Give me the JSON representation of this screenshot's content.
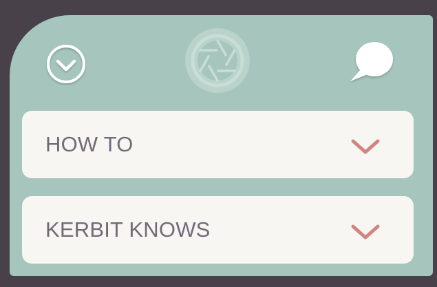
{
  "header": {
    "collapse_icon": "chevron-down-circle-icon",
    "logo_icon": "camera-aperture-icon",
    "chat_icon": "speech-bubble-icon"
  },
  "accordion": {
    "items": [
      {
        "label": "HOW TO",
        "icon": "chevron-down-icon"
      },
      {
        "label": "KERBIT KNOWS",
        "icon": "chevron-down-icon"
      }
    ]
  },
  "colors": {
    "background": "#48414a",
    "panel": "#a6c6bd",
    "card": "#f7f6f3",
    "label_text": "#736a77",
    "chevron": "#d08580",
    "white": "#ffffff"
  }
}
